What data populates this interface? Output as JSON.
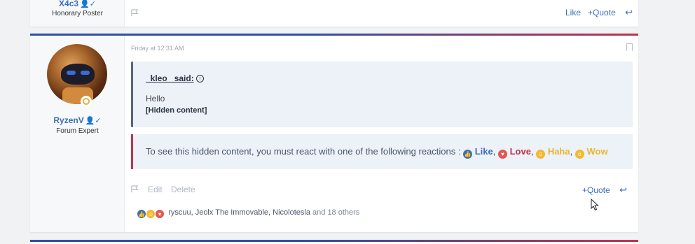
{
  "colors": {
    "accent_blue": "#3d6fb6",
    "accent_red": "#c0334a",
    "quote_bg": "#edf2f9",
    "like": "#3d6fb6",
    "love": "#c0334a",
    "haha": "#e8b830",
    "wow": "#e8b830"
  },
  "prev_post": {
    "username": "X4c3",
    "user_title": "Honorary Poster",
    "like_label": "Like",
    "quote_label": "Quote"
  },
  "post": {
    "username": "RyzenV",
    "user_title": "Forum Expert",
    "timestamp": "Friday at 12:31 AM",
    "quote": {
      "attribution": "_kleo_ said:",
      "line1": "Hello",
      "line2": "[Hidden content]"
    },
    "hidden_notice": {
      "text": "To see this hidden content, you must react with one of the following reactions :",
      "like": "Like",
      "love": "Love",
      "haha": "Haha",
      "wow": "Wow"
    },
    "actions": {
      "edit": "Edit",
      "delete": "Delete",
      "quote": "Quote"
    },
    "reactions": {
      "names": "ryscuu, Jeolx The Immovable, Nicolotesla",
      "others": "and 18 others"
    }
  },
  "icons": {
    "plus": "+",
    "reply": "⤺",
    "verified": "user-check-icon"
  }
}
